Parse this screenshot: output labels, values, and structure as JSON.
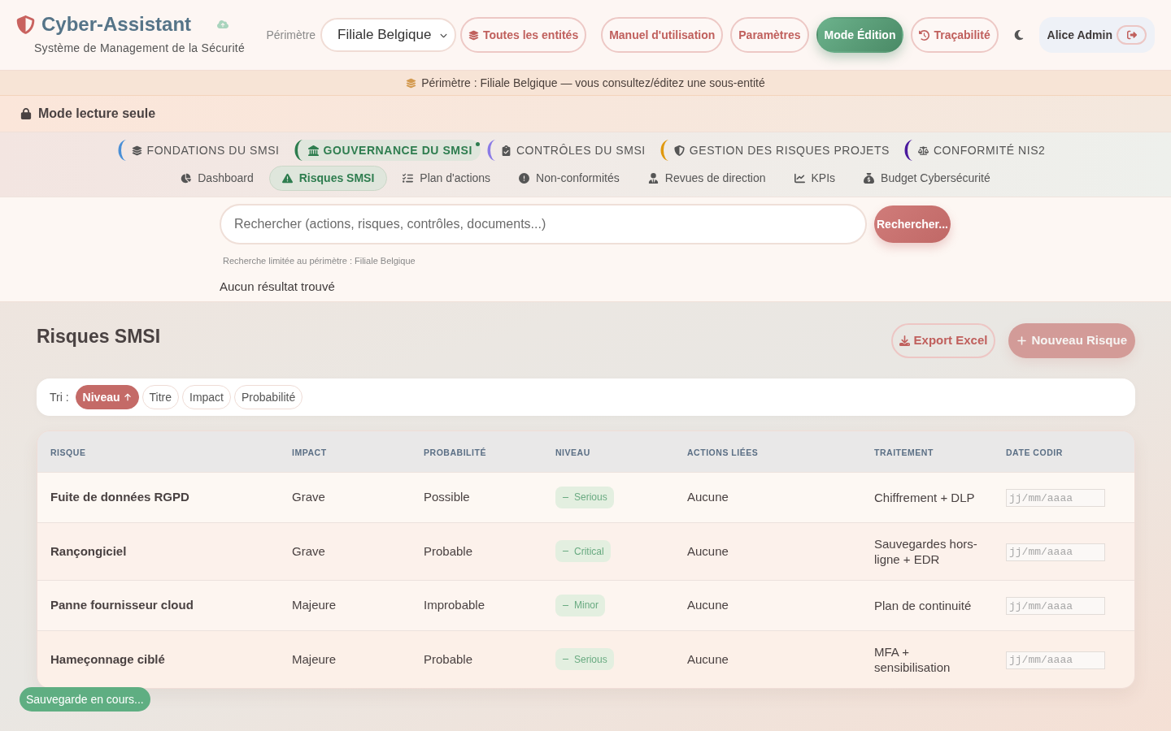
{
  "header": {
    "app_title": "Cyber-Assistant",
    "subtitle": "Système de Management de la Sécurité",
    "perimeter_label": "Périmètre",
    "perimeter_select": {
      "value": "Filiale Belgique"
    },
    "buttons": [
      {
        "label": "Toutes les entités",
        "kind": "outline"
      },
      {
        "label": "Manuel d'utilisation",
        "kind": "outline"
      },
      {
        "label": "Paramètres",
        "kind": "outline"
      },
      {
        "label": "Mode Édition",
        "kind": "primary"
      },
      {
        "label": "Traçabilité",
        "kind": "outline"
      }
    ],
    "user": {
      "name": "Alice Admin"
    }
  },
  "perimeter_banner": "Périmètre : Filiale Belgique — vous consultez/éditez une sous-entité",
  "mode_bar": "Mode lecture seule",
  "nav": {
    "groups": [
      {
        "label": "FONDATIONS DU SMSI",
        "selected": false,
        "color": "#4a8fd6"
      },
      {
        "label": "GOUVERNANCE DU SMSI",
        "selected": true,
        "color": "#2e7d4f"
      },
      {
        "label": "CONTRÔLES DU SMSI",
        "selected": false,
        "color": "#8b7be6"
      },
      {
        "label": "GESTION DES RISQUES PROJETS",
        "selected": false,
        "color": "#e0990f"
      },
      {
        "label": "CONFORMITÉ NIS2",
        "selected": false,
        "color": "#4b1a9e"
      }
    ],
    "tabs": [
      {
        "label": "Dashboard",
        "selected": false
      },
      {
        "label": "Risques SMSI",
        "selected": true
      },
      {
        "label": "Plan d'actions",
        "selected": false
      },
      {
        "label": "Non-conformités",
        "selected": false
      },
      {
        "label": "Revues de direction",
        "selected": false
      },
      {
        "label": "KPIs",
        "selected": false
      },
      {
        "label": "Budget Cybersécurité",
        "selected": false
      }
    ]
  },
  "search": {
    "placeholder": "Rechercher (actions, risques, contrôles, documents...)",
    "button": "Rechercher...",
    "hint": "Recherche limitée au périmètre : Filiale Belgique",
    "result": "Aucun résultat trouvé"
  },
  "page": {
    "title": "Risques SMSI",
    "buttons": [
      {
        "label": "Export Excel",
        "kind": "outline",
        "disabled": false
      },
      {
        "label": "Nouveau Risque",
        "kind": "primary",
        "disabled": true
      }
    ]
  },
  "sort_bar": {
    "label": "Tri :",
    "options": [
      {
        "label": "Niveau",
        "selected": true
      },
      {
        "label": "Titre",
        "selected": false
      },
      {
        "label": "Impact",
        "selected": false
      },
      {
        "label": "Probabilité",
        "selected": false
      }
    ]
  },
  "table": {
    "columns": [
      "RISQUE",
      "IMPACT",
      "PROBABILITÉ",
      "NIVEAU",
      "ACTIONS LIÉES",
      "TRAITEMENT",
      "DATE CODIR"
    ],
    "rows": [
      {
        "risk": "Fuite de données RGPD",
        "impact": "Grave",
        "probability": "Possible",
        "level": "Serious",
        "actions": "Aucune",
        "treatment": "Chiffrement + DLP",
        "date_codir": {
          "placeholder": "jj/mm/aaaa"
        }
      },
      {
        "risk": "Rançongiciel",
        "impact": "Grave",
        "probability": "Probable",
        "level": "Critical",
        "actions": "Aucune",
        "treatment": "Sauvegardes hors-ligne + EDR",
        "date_codir": {
          "placeholder": "jj/mm/aaaa"
        }
      },
      {
        "risk": "Panne fournisseur cloud",
        "impact": "Majeure",
        "probability": "Improbable",
        "level": "Minor",
        "actions": "Aucune",
        "treatment": "Plan de continuité",
        "date_codir": {
          "placeholder": "jj/mm/aaaa"
        }
      },
      {
        "risk": "Hameçonnage ciblé",
        "impact": "Majeure",
        "probability": "Probable",
        "level": "Serious",
        "actions": "Aucune",
        "treatment": "MFA + sensibilisation",
        "date_codir": {
          "placeholder": "jj/mm/aaaa"
        }
      }
    ]
  },
  "toast": "Sauvegarde en cours..."
}
